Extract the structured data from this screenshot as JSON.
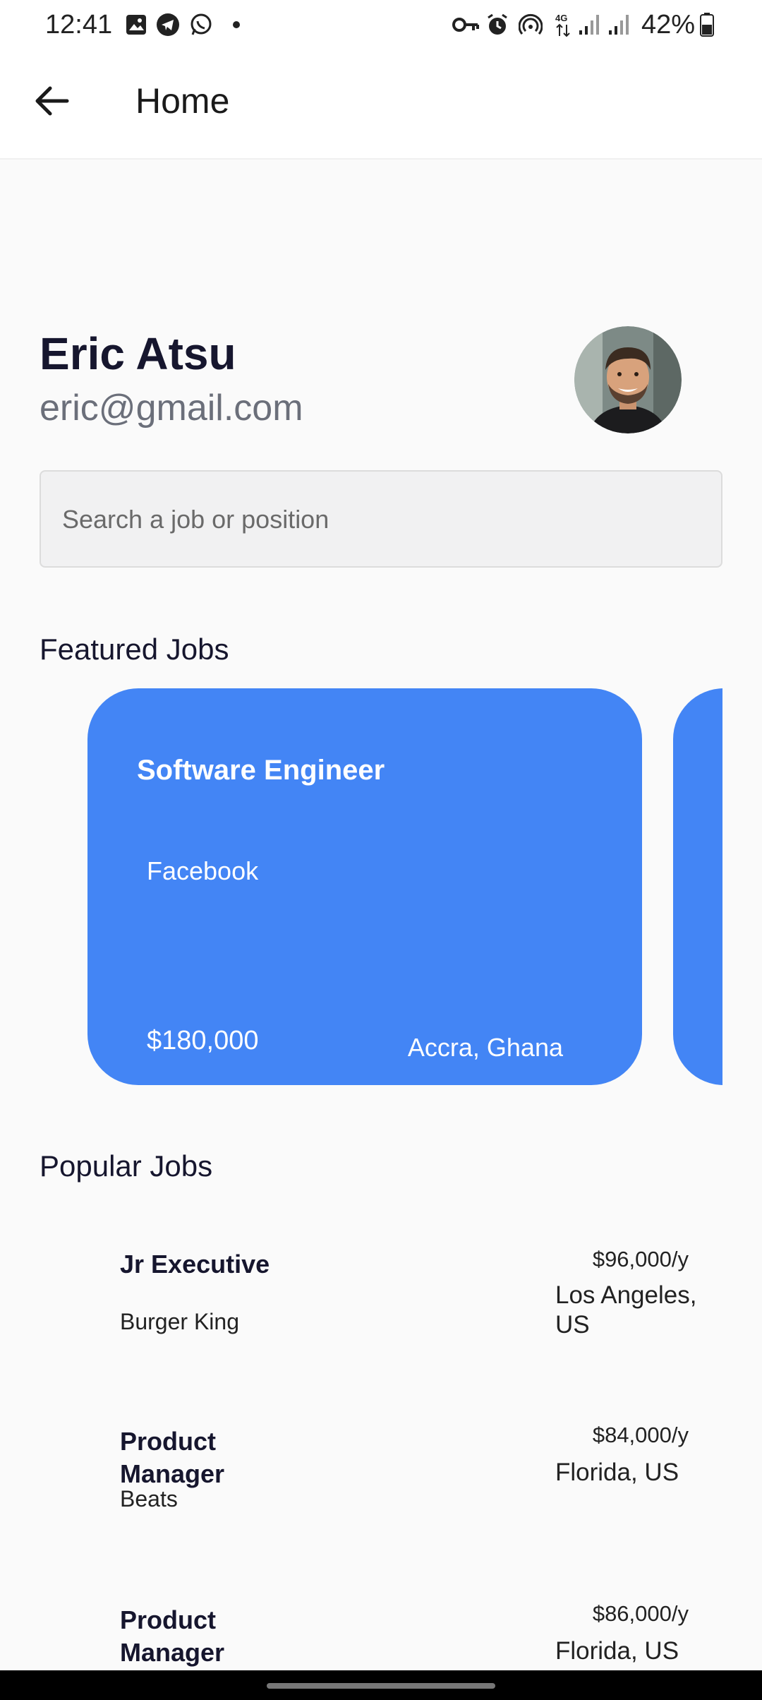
{
  "status_bar": {
    "time": "12:41",
    "battery_pct": "42%",
    "icons": [
      "gallery-icon",
      "telegram-icon",
      "whatsapp-icon",
      "dot-icon",
      "key-icon",
      "alarm-icon",
      "hotspot-icon",
      "4g-icon",
      "signal-icon",
      "signal-icon",
      "battery-icon"
    ]
  },
  "app_bar": {
    "title": "Home",
    "back_icon": "arrow-left-icon"
  },
  "profile": {
    "name": "Eric Atsu",
    "email": "eric@gmail.com"
  },
  "search": {
    "placeholder": "Search a job or position",
    "value": ""
  },
  "featured": {
    "title": "Featured Jobs",
    "cards": [
      {
        "title": "Software Engineer",
        "company": "Facebook",
        "salary": "$180,000",
        "location": "Accra, Ghana"
      }
    ],
    "card_color": "#4385f5"
  },
  "popular": {
    "title": "Popular Jobs",
    "items": [
      {
        "title": "Jr Executive",
        "company": "Burger King",
        "salary": "$96,000/y",
        "location": "Los Angeles, US"
      },
      {
        "title": "Product Manager",
        "company": "Beats",
        "salary": "$84,000/y",
        "location": "Florida, US"
      },
      {
        "title": "Product Manager",
        "company": "",
        "salary": "$86,000/y",
        "location": "Florida, US"
      }
    ]
  }
}
